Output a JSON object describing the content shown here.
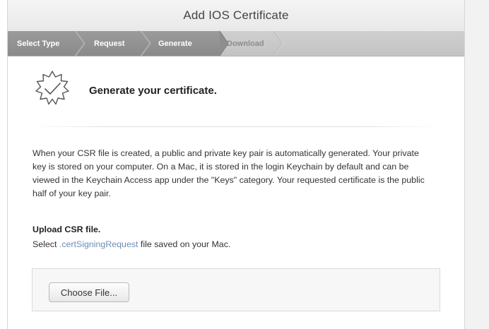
{
  "header": {
    "title": "Add IOS Certificate"
  },
  "steps": [
    {
      "label": "Select Type",
      "state": "done"
    },
    {
      "label": "Request",
      "state": "done"
    },
    {
      "label": "Generate",
      "state": "done"
    },
    {
      "label": "Download",
      "state": "todo"
    }
  ],
  "main": {
    "icon": "certificate-checkmark-icon",
    "heading": "Generate your certificate.",
    "description": "When your CSR file is created, a public and private key pair is automatically generated. Your private key is stored on your computer. On a Mac, it is stored in the login Keychain by default and can be viewed in the Keychain Access app under the \"Keys\" category. Your requested certificate is the public half of your key pair.",
    "upload": {
      "heading": "Upload CSR file.",
      "sub_prefix": "Select ",
      "sub_ext": ".certSigningRequest",
      "sub_suffix": " file saved on your Mac.",
      "button_label": "Choose File..."
    }
  },
  "colors": {
    "step_done_bg": "#8f8f8f",
    "step_todo_bg": "#c9c9c9",
    "link_text": "#6e8db3"
  }
}
